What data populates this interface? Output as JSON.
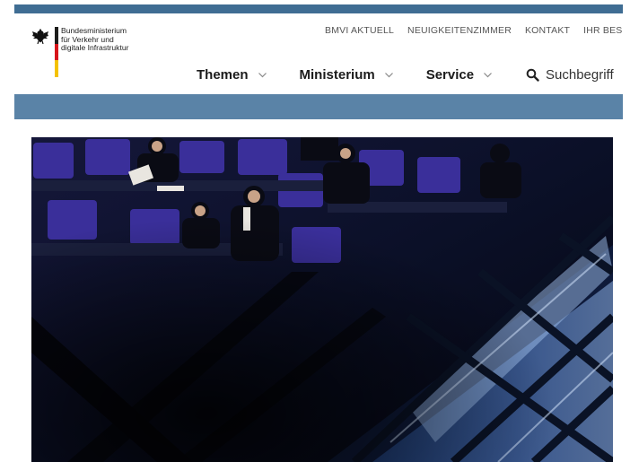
{
  "logo": {
    "line1": "Bundesministerium",
    "line2": "für Verkehr und",
    "line3": "digitale Infrastruktur"
  },
  "meta_nav": [
    {
      "label": "BMVI AKTUELL"
    },
    {
      "label": "NEUIGKEITENZIMMER"
    },
    {
      "label": "KONTAKT"
    },
    {
      "label": "IHR BESUC"
    }
  ],
  "main_nav": [
    {
      "label": "Themen"
    },
    {
      "label": "Ministerium"
    },
    {
      "label": "Service"
    }
  ],
  "search": {
    "placeholder": "Suchbegriff",
    "icon": "search-icon"
  },
  "colors": {
    "top_band": "#3f6d93",
    "sub_band": "#5a83a7",
    "flag_black": "#1d1d1b",
    "flag_red": "#d7141a",
    "flag_gold": "#f4c200"
  }
}
